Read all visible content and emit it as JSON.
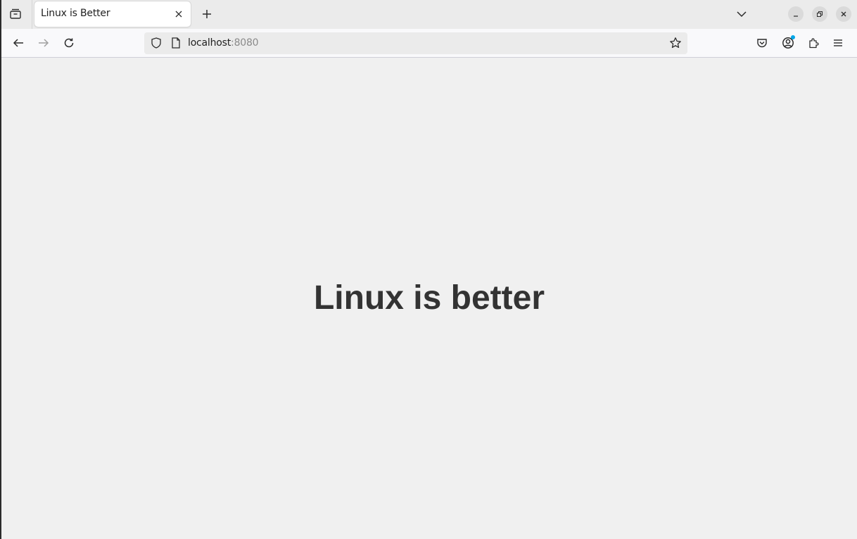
{
  "browser": {
    "tab": {
      "title": "Linux is Better"
    },
    "address": {
      "host": "localhost",
      "port": ":8080"
    },
    "icons": {
      "overview": "tab-overview-icon",
      "new_tab": "plus-icon",
      "list_tabs": "chevron-down-icon",
      "minimize": "minimize-icon",
      "maximize": "restore-icon",
      "close": "close-icon",
      "back": "arrow-left-icon",
      "forward": "arrow-right-icon",
      "reload": "reload-icon",
      "tracking": "shield-icon",
      "page": "page-icon",
      "bookmark": "star-icon",
      "pocket": "pocket-icon",
      "account": "account-icon",
      "extensions": "puzzle-icon",
      "menu": "hamburger-menu-icon"
    }
  },
  "page": {
    "headline": "Linux is better"
  },
  "colors": {
    "content_background": "#f0f0f0",
    "headline": "#333333",
    "notification_dot": "#00a6e8"
  }
}
